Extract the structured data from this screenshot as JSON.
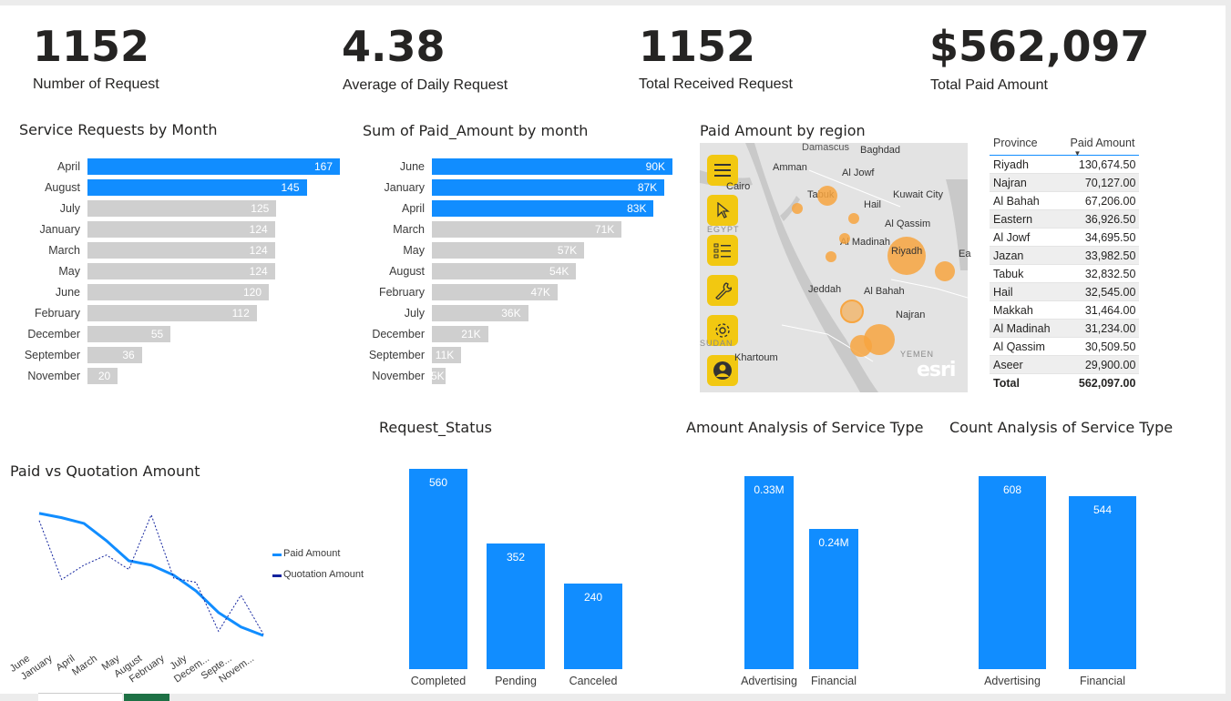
{
  "kpis": [
    {
      "value": "1152",
      "label": "Number of Request"
    },
    {
      "value": "4.38",
      "label": "Average of Daily Request"
    },
    {
      "value": "1152",
      "label": "Total Received Request"
    },
    {
      "value": "$562,097",
      "label": "Total Paid Amount"
    }
  ],
  "colors": {
    "accent": "#118dff",
    "muted_bar": "#cfcfcf",
    "map_button": "#f2c811",
    "bubble": "#f7a540",
    "quotation": "#12239e"
  },
  "service_requests": {
    "title": "Service Requests by Month",
    "chart_data": {
      "type": "bar",
      "categories": [
        "April",
        "August",
        "July",
        "January",
        "March",
        "May",
        "June",
        "February",
        "December",
        "September",
        "November"
      ],
      "values": [
        167,
        145,
        125,
        124,
        124,
        124,
        120,
        112,
        55,
        36,
        20
      ],
      "labels": [
        "167",
        "145",
        "125",
        "124",
        "124",
        "124",
        "120",
        "112",
        "55",
        "36",
        "20"
      ],
      "highlighted": [
        true,
        true,
        false,
        false,
        false,
        false,
        false,
        false,
        false,
        false,
        false
      ],
      "xlim": [
        0,
        167
      ]
    }
  },
  "paid_by_month": {
    "title": "Sum of Paid_Amount by month",
    "chart_data": {
      "type": "bar",
      "categories": [
        "June",
        "January",
        "April",
        "March",
        "May",
        "August",
        "February",
        "July",
        "December",
        "September",
        "November"
      ],
      "values": [
        90000,
        87000,
        83000,
        71000,
        57000,
        54000,
        47000,
        36000,
        21000,
        11000,
        5000
      ],
      "labels": [
        "90K",
        "87K",
        "83K",
        "71K",
        "57K",
        "54K",
        "47K",
        "36K",
        "21K",
        "11K",
        "5K"
      ],
      "highlighted": [
        true,
        true,
        true,
        false,
        false,
        false,
        false,
        false,
        false,
        false,
        false
      ],
      "xlim": [
        0,
        90000
      ]
    }
  },
  "map": {
    "title": "Paid Amount by region",
    "tool_icons": [
      "menu-icon",
      "cursor-icon",
      "list-icon",
      "wrench-icon",
      "gear-icon",
      "user-icon"
    ],
    "places": [
      "Damascus",
      "Baghdad",
      "Amman",
      "Al Jowf",
      "Cairo",
      "Tabuk",
      "Kuwait City",
      "Hail",
      "Al Qassim",
      "Al Madinah",
      "Riyadh",
      "Ea",
      "Jeddah",
      "Al Bahah",
      "Najran",
      "Khartoum"
    ],
    "region_labels": [
      "EGYPT",
      "SUDAN",
      "YEMEN"
    ],
    "brand": "esri"
  },
  "province_table": {
    "headers": [
      "Province",
      "Paid Amount"
    ],
    "rows": [
      [
        "Riyadh",
        "130,674.50"
      ],
      [
        "Najran",
        "70,127.00"
      ],
      [
        "Al Bahah",
        "67,206.00"
      ],
      [
        "Eastern",
        "36,926.50"
      ],
      [
        "Al Jowf",
        "34,695.50"
      ],
      [
        "Jazan",
        "33,982.50"
      ],
      [
        "Tabuk",
        "32,832.50"
      ],
      [
        "Hail",
        "32,545.00"
      ],
      [
        "Makkah",
        "31,464.00"
      ],
      [
        "Al Madinah",
        "31,234.00"
      ],
      [
        "Al Qassim",
        "30,509.50"
      ],
      [
        "Aseer",
        "29,900.00"
      ]
    ],
    "total_label": "Total",
    "total_value": "562,097.00"
  },
  "paid_vs_quotation": {
    "title": "Paid vs Quotation Amount",
    "chart_data": {
      "type": "line",
      "categories": [
        "June",
        "January",
        "April",
        "March",
        "May",
        "August",
        "February",
        "July",
        "December",
        "September",
        "November"
      ],
      "tick_labels": [
        "June",
        "January",
        "April",
        "March",
        "May",
        "August",
        "February",
        "July",
        "Decem...",
        "Septe...",
        "Novem..."
      ],
      "series": [
        {
          "name": "Paid Amount",
          "values": [
            90000,
            87000,
            83000,
            71000,
            57000,
            54000,
            47000,
            36000,
            21000,
            11000,
            5000
          ]
        },
        {
          "name": "Quotation Amount",
          "values": [
            85000,
            44000,
            54000,
            61000,
            51000,
            89000,
            45000,
            42000,
            8000,
            33000,
            6000
          ]
        }
      ],
      "legend": "right"
    }
  },
  "request_status": {
    "title": "Request_Status",
    "chart_data": {
      "type": "bar",
      "categories": [
        "Completed",
        "Pending",
        "Canceled"
      ],
      "values": [
        560,
        352,
        240
      ],
      "labels": [
        "560",
        "352",
        "240"
      ],
      "ylim": [
        0,
        560
      ]
    }
  },
  "amount_service": {
    "title": "Amount Analysis of Service Type",
    "chart_data": {
      "type": "bar",
      "categories": [
        "Advertising",
        "Financial"
      ],
      "values": [
        330000,
        240000
      ],
      "labels": [
        "0.33M",
        "0.24M"
      ],
      "ylim": [
        0,
        330000
      ]
    }
  },
  "count_service": {
    "title": "Count Analysis of Service Type",
    "chart_data": {
      "type": "bar",
      "categories": [
        "Advertising",
        "Financial"
      ],
      "values": [
        608,
        544
      ],
      "labels": [
        "608",
        "544"
      ],
      "ylim": [
        0,
        608
      ]
    }
  }
}
